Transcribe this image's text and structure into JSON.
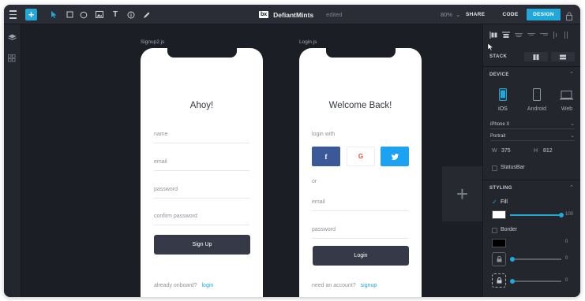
{
  "topbar": {
    "app_title": "DefiantMints",
    "logo_text": "bx",
    "status": "edited",
    "zoom": "80%",
    "share_label": "SHARE",
    "code_label": "CODE",
    "design_label": "DESIGN"
  },
  "canvas": {
    "artboards": [
      {
        "label": "Signup2.js",
        "title": "Ahoy!",
        "fields": [
          "name",
          "email",
          "password",
          "confirm password"
        ],
        "button": "Sign Up",
        "footer_text": "already onboard?",
        "footer_link": "login"
      },
      {
        "label": "Login.js",
        "title": "Welcome Back!",
        "login_with": "login with",
        "social": [
          {
            "letter": "f",
            "name": "facebook",
            "color": "#3b5998"
          },
          {
            "letter": "G",
            "name": "google",
            "color": "#ffffff"
          },
          {
            "letter": "t",
            "name": "twitter",
            "color": "#1da1f2"
          }
        ],
        "or": "or",
        "fields": [
          "email",
          "password"
        ],
        "button": "Login",
        "footer_text": "need an account?",
        "footer_link": "signup"
      }
    ],
    "add_artboard_symbol": "+"
  },
  "panel": {
    "stack_label": "STACK",
    "device_section": "DEVICE",
    "devices": [
      {
        "label": "iOS",
        "selected": true
      },
      {
        "label": "Android",
        "selected": false
      },
      {
        "label": "Web",
        "selected": false
      }
    ],
    "model": "iPhone X",
    "orientation": "Portrait",
    "w_label": "W",
    "w_value": "375",
    "h_label": "H",
    "h_value": "812",
    "statusbar_label": "StatusBar",
    "styling_section": "STYLING",
    "fill_label": "Fill",
    "fill_checked": true,
    "fill_opacity": "100",
    "border_label": "Border",
    "border_checked": false,
    "border_width": "0",
    "radius_value": "0",
    "shadow_value": "0",
    "accent_color": "#21a8d8"
  }
}
